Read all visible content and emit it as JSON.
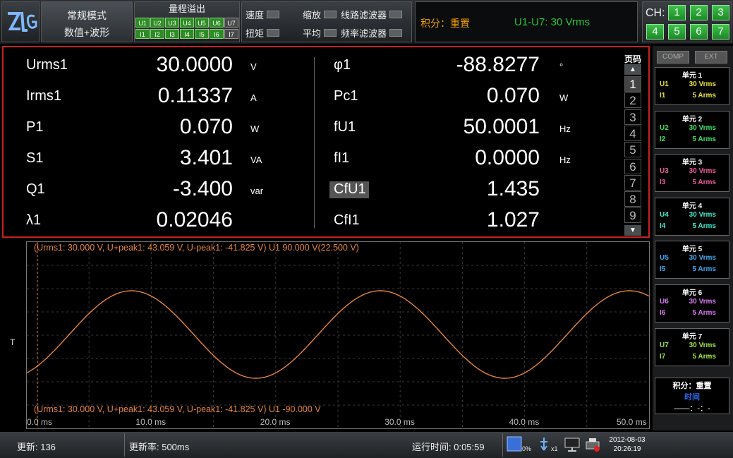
{
  "app": {
    "logo_alt": "ZLG"
  },
  "mode": {
    "line1": "常规模式",
    "line2": "数值+波形"
  },
  "range_overflow": {
    "title": "量程溢出",
    "u_chips": [
      "U1",
      "U2",
      "U3",
      "U4",
      "U5",
      "U6",
      "U7"
    ],
    "i_chips": [
      "I1",
      "I2",
      "I3",
      "I4",
      "I5",
      "I6",
      "I7"
    ]
  },
  "options": {
    "speed": "速度",
    "torque": "扭矩",
    "zoom": "缩放",
    "average": "平均",
    "line_filter": "线路滤波器",
    "freq_filter": "频率滤波器"
  },
  "integration_header": {
    "label": "积分：重置",
    "range_text": "U1-U7: 30 Vrms"
  },
  "channels": {
    "label": "CH:",
    "buttons": [
      "1",
      "2",
      "3",
      "4",
      "5",
      "6",
      "7"
    ]
  },
  "measurements": {
    "left": [
      {
        "label": "Urms1",
        "value": "30.0000",
        "unit": "V"
      },
      {
        "label": "Irms1",
        "value": "0.11337",
        "unit": "A"
      },
      {
        "label": "P1",
        "value": "0.070",
        "unit": "W"
      },
      {
        "label": "S1",
        "value": "3.401",
        "unit": "VA"
      },
      {
        "label": "Q1",
        "value": "-3.400",
        "unit": "var"
      },
      {
        "label": "λ1",
        "value": "0.02046",
        "unit": ""
      }
    ],
    "right": [
      {
        "label": "φ1",
        "value": "-88.8277",
        "unit": "°"
      },
      {
        "label": "Pc1",
        "value": "0.070",
        "unit": "W"
      },
      {
        "label": "fU1",
        "value": "50.0001",
        "unit": "Hz"
      },
      {
        "label": "fI1",
        "value": "0.0000",
        "unit": "Hz"
      },
      {
        "label": "CfU1",
        "value": "1.435",
        "unit": ""
      },
      {
        "label": "CfI1",
        "value": "1.027",
        "unit": ""
      }
    ]
  },
  "pager": {
    "title": "页码",
    "pages": [
      "1",
      "2",
      "3",
      "4",
      "5",
      "6",
      "7",
      "8",
      "9"
    ],
    "selected": "1",
    "up": "▲",
    "down": "▼"
  },
  "waveform": {
    "top_label": "(Urms1: 30.000 V, U+peak1: 43.059 V, U-peak1: -41.825 V) U1    90.000 V(22.500 V)",
    "bottom_label": "(Urms1: 30.000 V, U+peak1: 43.059 V, U-peak1: -41.825 V) U1    -90.000 V",
    "trigger_label": "T",
    "time_ticks": [
      "0.0 ms",
      "10.0 ms",
      "20.0 ms",
      "30.0 ms",
      "40.0 ms",
      "50.0 ms"
    ],
    "wave_color": "#e6843c"
  },
  "sidebar": {
    "comp": "COMP",
    "ext": "EXT",
    "units": [
      {
        "title": "单元 1",
        "u": "U1",
        "u_val": "30 Vrms",
        "i": "I1",
        "i_val": "5 Arms",
        "color": "#e8e03a"
      },
      {
        "title": "单元 2",
        "u": "U2",
        "u_val": "30 Vrms",
        "i": "I2",
        "i_val": "5 Arms",
        "color": "#3ee06a"
      },
      {
        "title": "单元 3",
        "u": "U3",
        "u_val": "30 Vrms",
        "i": "I3",
        "i_val": "5 Arms",
        "color": "#f05a9e"
      },
      {
        "title": "单元 4",
        "u": "U4",
        "u_val": "30 Vrms",
        "i": "I4",
        "i_val": "5 Arms",
        "color": "#40e8c8"
      },
      {
        "title": "单元 5",
        "u": "U5",
        "u_val": "30 Vrms",
        "i": "I5",
        "i_val": "5 Arms",
        "color": "#40a8f0"
      },
      {
        "title": "单元 6",
        "u": "U6",
        "u_val": "30 Vrms",
        "i": "I6",
        "i_val": "5 Arms",
        "color": "#d878f0"
      },
      {
        "title": "单元 7",
        "u": "U7",
        "u_val": "30 Vrms",
        "i": "I7",
        "i_val": "5 Arms",
        "color": "#9ee640"
      }
    ],
    "integration": {
      "title": "积分：重置",
      "sub": "时间",
      "value": "——：-：-"
    }
  },
  "status": {
    "update_label": "更新: 136",
    "rate_label": "更新率: 500ms",
    "runtime_label": "运行时间: 0:05:59",
    "storage_pct": "0%",
    "usb_count": "x1",
    "date": "2012-08-03",
    "time": "20:26:19"
  }
}
